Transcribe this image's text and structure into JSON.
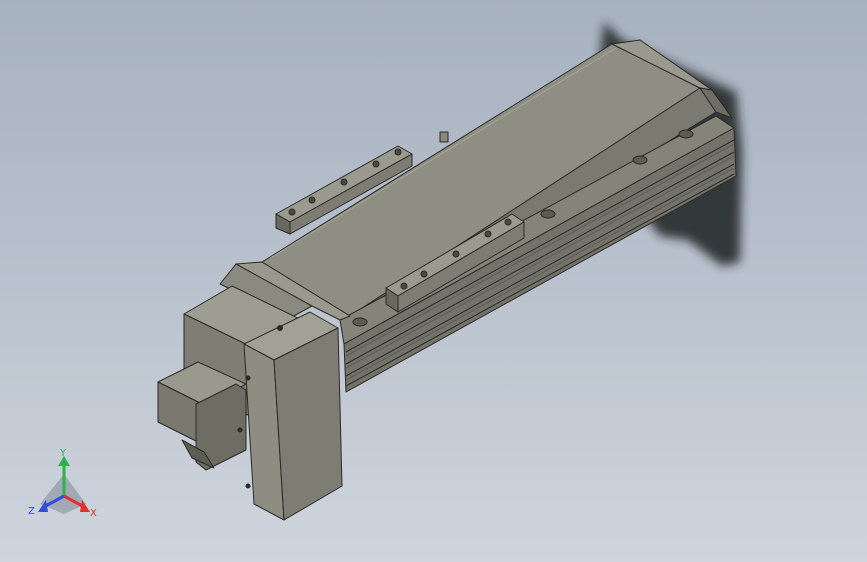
{
  "view": {
    "background_top": "#a7b2c0",
    "background_bottom": "#cfd5dd",
    "model_color": "#8f8e83",
    "edge_color": "#2a2a26"
  },
  "triad": {
    "x_label": "X",
    "y_label": "Y",
    "z_label": "Z",
    "x_color": "#e0312b",
    "y_color": "#2bb24a",
    "z_color": "#2f4fd6"
  }
}
